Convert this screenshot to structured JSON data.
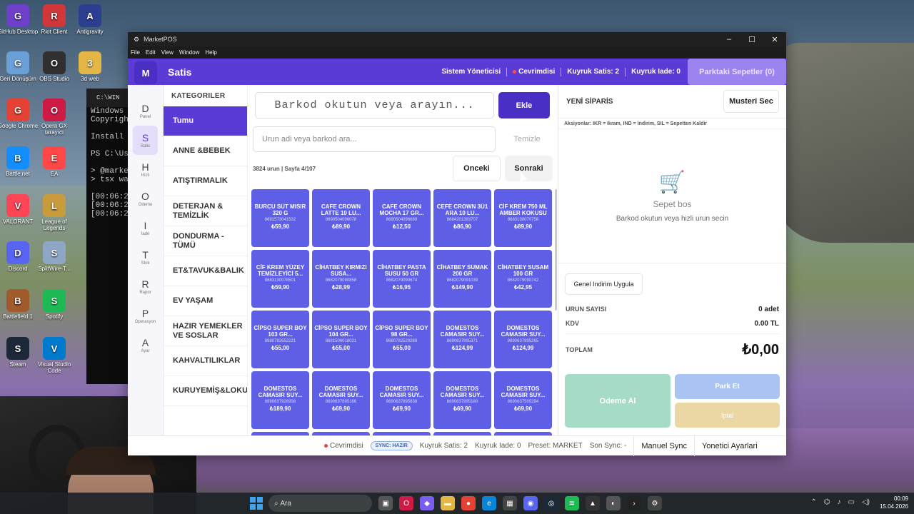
{
  "desktop": {
    "icons": [
      {
        "label": "GitHub Desktop",
        "icon": "github-icon",
        "color": "#6e40c9"
      },
      {
        "label": "Riot Client",
        "icon": "riot-icon",
        "color": "#d13639"
      },
      {
        "label": "Antigravity",
        "icon": "antigravity-icon",
        "color": "#2c3e8f"
      },
      {
        "label": "Geri Dönüşüm",
        "icon": "recycle-bin-icon",
        "color": "#6aa0d8"
      },
      {
        "label": "OBS Studio",
        "icon": "obs-icon",
        "color": "#303030"
      },
      {
        "label": "3d web",
        "icon": "folder-icon",
        "color": "#e3b646"
      },
      {
        "label": "Google Chrome",
        "icon": "chrome-icon",
        "color": "#e34234"
      },
      {
        "label": "Opera GX tarayıcı",
        "icon": "opera-icon",
        "color": "#ce1b46"
      },
      {
        "label": "Battle.net",
        "icon": "battlenet-icon",
        "color": "#148eff"
      },
      {
        "label": "EA",
        "icon": "ea-icon",
        "color": "#ff4747"
      },
      {
        "label": "VALORANT",
        "icon": "valorant-icon",
        "color": "#fd4556"
      },
      {
        "label": "League of Legends",
        "icon": "lol-icon",
        "color": "#c89b3c"
      },
      {
        "label": "Discord",
        "icon": "discord-icon",
        "color": "#5865f2"
      },
      {
        "label": "SplitWire-T...",
        "icon": "splitwire-icon",
        "color": "#8fa7c6"
      },
      {
        "label": "Battlefield 1",
        "icon": "battlefield-icon",
        "color": "#a05a2c"
      },
      {
        "label": "Spotify",
        "icon": "spotify-icon",
        "color": "#1db954"
      },
      {
        "label": "Steam",
        "icon": "steam-icon",
        "color": "#1b2838"
      },
      {
        "label": "Visual Studio Code",
        "icon": "vscode-icon",
        "color": "#007acc"
      }
    ]
  },
  "terminal": {
    "title": "C:\\WIN",
    "lines": [
      "Windows P",
      "Copyright",
      "",
      "Install t",
      "",
      "PS C:\\Use",
      "",
      "> @market",
      "> tsx wat",
      "",
      "[00:06:27",
      "[00:06:27",
      "[00:06:27"
    ]
  },
  "window": {
    "title": "MarketPOS",
    "menu": [
      "File",
      "Edit",
      "View",
      "Window",
      "Help"
    ]
  },
  "header": {
    "logo": "M",
    "title": "Satis",
    "user": "Sistem Yöneticisi",
    "status": "Cevrimdisi",
    "queue_sales": "Kuyruk Satis: 2",
    "queue_returns": "Kuyruk Iade: 0",
    "parked": "Parktaki Sepetler (0)"
  },
  "rail": [
    {
      "letter": "D",
      "label": "Panel"
    },
    {
      "letter": "S",
      "label": "Satis",
      "active": true
    },
    {
      "letter": "H",
      "label": "Hizli"
    },
    {
      "letter": "O",
      "label": "Odeme"
    },
    {
      "letter": "I",
      "label": "Iade"
    },
    {
      "letter": "T",
      "label": "Stok"
    },
    {
      "letter": "R",
      "label": "Rapor"
    },
    {
      "letter": "P",
      "label": "Operasyon"
    },
    {
      "letter": "A",
      "label": "Ayar"
    }
  ],
  "categories": {
    "header": "KATEGORILER",
    "items": [
      "Tumu",
      "ANNE &BEBEK",
      "ATIŞTIRMALIK",
      "DETERJAN & TEMİZLİK",
      "DONDURMA - TÜMÜ",
      "ET&TAVUK&BALIK",
      "EV YAŞAM",
      "HAZIR YEMEKLER VE SOSLAR",
      "KAHVALTILIKLAR",
      "KURUYEMİŞ&LOKU"
    ]
  },
  "search": {
    "barcode_placeholder": "Barkod okutun veya arayın...",
    "add_button": "Ekle",
    "name_placeholder": "Urun adi veya barkod ara...",
    "clear_button": "Temizle",
    "page_info": "3824 urun | Sayfa 4/107",
    "prev_button": "Onceki",
    "next_button": "Sonraki"
  },
  "products": [
    {
      "name": "BURCU SÜT MISIR 320 G",
      "barcode": "8691573041532",
      "price": "₺59,90"
    },
    {
      "name": "CAFE CROWN LATTE 10 LU...",
      "barcode": "8690504096078",
      "price": "₺89,90"
    },
    {
      "name": "CAFE CROWN MOCHA 17 GR...",
      "barcode": "8690504096689",
      "price": "₺12,50"
    },
    {
      "name": "CEFE CROWN 3Ü1 ARA 10 LU...",
      "barcode": "8684201393707",
      "price": "₺86,90"
    },
    {
      "name": "CİF KREM 750 ML AMBER KOKUSU",
      "barcode": "8683130070758",
      "price": "₺89,90"
    },
    {
      "name": "CİF KREM YÜZEY TEMİZLEYİCİ 5...",
      "barcode": "8683130078501",
      "price": "₺59,90"
    },
    {
      "name": "CİHATBEY KIRMIZI SUSA...",
      "barcode": "8682079090858",
      "price": "₺28,99"
    },
    {
      "name": "CİHATBEY PASTA SUSU 50 GR",
      "barcode": "8682079090674",
      "price": "₺16,95"
    },
    {
      "name": "CİHATBEY SUMAK 200 GR",
      "barcode": "8682079091039",
      "price": "₺149,90"
    },
    {
      "name": "CİHATBEY SUSAM 100 GR",
      "barcode": "8682079090742",
      "price": "₺42,95"
    },
    {
      "name": "CİPSO SUPER BOY 103 GR...",
      "barcode": "8680782652221",
      "price": "₺55,00"
    },
    {
      "name": "CİPSO SUPER BOY 104 GR...",
      "barcode": "8681506018021",
      "price": "₺55,00"
    },
    {
      "name": "CİPSO SUPER BOY 98 GR...",
      "barcode": "8680782529269",
      "price": "₺55,00"
    },
    {
      "name": "DOMESTOS CAMASIR SUY...",
      "barcode": "8690637895371",
      "price": "₺124,99"
    },
    {
      "name": "DOMESTOS CAMASIR SUY...",
      "barcode": "8690637895265",
      "price": "₺124,99"
    },
    {
      "name": "DOMESTOS CAMASIR SUY...",
      "barcode": "8690637926938",
      "price": "₺189,90"
    },
    {
      "name": "DOMESTOS CAMASIR SUY...",
      "barcode": "8690637895166",
      "price": "₺69,90"
    },
    {
      "name": "DOMESTOS CAMASIR SUY...",
      "barcode": "8690637895838",
      "price": "₺69,90"
    },
    {
      "name": "DOMESTOS CAMASIR SUY...",
      "barcode": "8690637895180",
      "price": "₺69,90"
    },
    {
      "name": "DOMESTOS CAMASIR SUY...",
      "barcode": "8690637505294",
      "price": "₺69,90"
    },
    {
      "name": "",
      "barcode": "",
      "price": ""
    },
    {
      "name": "",
      "barcode": "",
      "price": ""
    },
    {
      "name": "",
      "barcode": "",
      "price": ""
    },
    {
      "name": "",
      "barcode": "",
      "price": ""
    },
    {
      "name": "",
      "barcode": "",
      "price": ""
    }
  ],
  "order": {
    "title": "YENİ SİPARİS",
    "customer_button": "Musteri Sec",
    "hint": "Aksiyonlar: IKR = Ikram, IND = Indirim, SIL = Sepetten Kaldir",
    "empty_title": "Sepet bos",
    "empty_sub": "Barkod okutun veya hizli urun secin",
    "discount_button": "Genel Indirim Uygula",
    "count_label": "URUN SAYISI",
    "count_value": "0 adet",
    "tax_label": "KDV",
    "tax_value": "0.00 TL",
    "total_label": "TOPLAM",
    "total_value": "₺0,00",
    "pay_button": "Odeme Al",
    "park_button": "Park Et",
    "cancel_button": "Iptal"
  },
  "statusbar": {
    "status": "Cevrimdisi",
    "sync_badge": "SYNC: HAZIR",
    "queue_sales": "Kuyruk Satis: 2",
    "queue_returns": "Kuyruk Iade: 0",
    "preset": "Preset: MARKET",
    "last_sync": "Son Sync: -",
    "manual_sync": "Manuel Sync",
    "admin_settings": "Yonetici Ayarlari"
  },
  "taskbar": {
    "search": "Ara",
    "time": "00:09",
    "date": "15.04.2026"
  },
  "colors": {
    "primary": "#5a3bd6",
    "product_tile": "#5e5ee6",
    "pay": "#a6dcc5",
    "park": "#a9c4f2",
    "cancel": "#ead7a3"
  }
}
